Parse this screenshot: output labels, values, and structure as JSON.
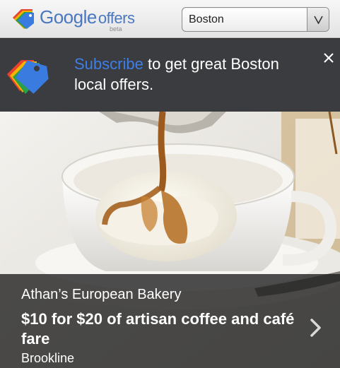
{
  "header": {
    "logo_word1": "Google",
    "logo_word2": "offers",
    "logo_beta": "beta",
    "city_select": {
      "selected": "Boston",
      "button_glyph": "V"
    }
  },
  "banner": {
    "link_text": "Subscribe",
    "rest_text": " to get great Boston local offers.",
    "icon": "offers-tag-icon",
    "close_icon": "close-icon",
    "link_color": "#3d7fe6",
    "bg_color": "#3b3c40"
  },
  "offer": {
    "merchant": "Athan’s European Bakery",
    "title": "$10 for $20 of artisan coffee and café fare",
    "location": "Brookline",
    "image": "affogato-coffee-cup-photo",
    "chevron_icon": "chevron-right-icon"
  }
}
